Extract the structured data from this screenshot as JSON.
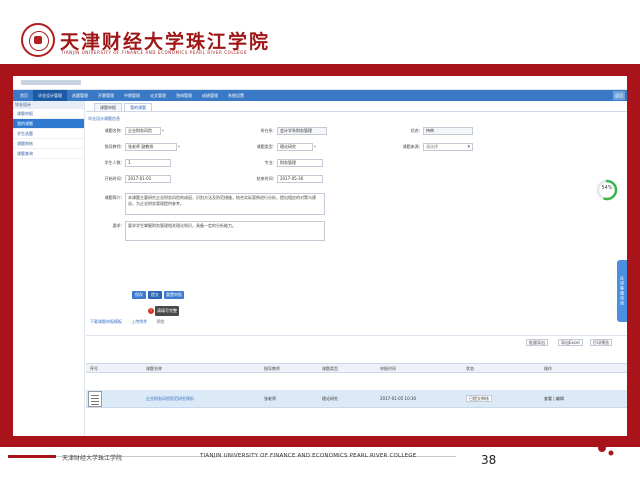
{
  "logo": {
    "cn": "天津财经大学珠江学院",
    "en": "TIANJIN UNIVERSITY OF FINANCE AND ECONOMICS PEARL RIVER COLLEGE"
  },
  "nav": {
    "items": [
      "首页",
      "毕业设计管理",
      "选题管理",
      "开题管理",
      "中期管理",
      "论文管理",
      "答辩管理",
      "成绩管理",
      "系统设置"
    ],
    "home": "返回"
  },
  "sidebar": {
    "head": "毕业设计",
    "items": [
      "课题申报",
      "我的课题",
      "学生选题",
      "课题审核",
      "课题查询"
    ]
  },
  "tabs": [
    "课题申报",
    "我的课题"
  ],
  "form": {
    "section_title": "毕业设计课题信息",
    "row1": {
      "label1": "课题名称:",
      "value1": "企业财务风险",
      "label2": "所在系:",
      "value2": "会计学系财务管理",
      "label3": "状态:",
      "value3": "待审"
    },
    "row2": {
      "label1": "指导教师:",
      "value1": "张老师 副教授",
      "label2": "课题类型:",
      "value2": "理论研究",
      "label3": "课题来源:",
      "value3": "请选择"
    },
    "row3": {
      "label1": "学生人数:",
      "value1": "1",
      "label2": "专业:",
      "value2": "财务管理"
    },
    "row4": {
      "label1": "开始时间:",
      "value1": "2017-01-01",
      "label2": "结束时间:",
      "value2": "2017-05-30"
    },
    "desc_label": "课题简介:",
    "desc_text": "本课题主要研究企业财务风险的成因、识别方法及防范措施，结合实际案例进行分析，提出相应的对策与建议，为企业财务管理提供参考。",
    "req_label": "要求:",
    "req_text": "要求学生掌握财务管理相关理论知识，具备一定的分析能力。"
  },
  "progress": {
    "value": 54,
    "text": "54%",
    "color": "#39b54a"
  },
  "buttons": {
    "save": "保存",
    "submit": "提交",
    "reset": "重置申报"
  },
  "tooltip": "请填写完整",
  "links": {
    "l1": "下载课题申报模板",
    "l2": "上传附件",
    "l3": "预览"
  },
  "side_float": "在线客服咨询",
  "toolbar": {
    "b1": "批量导出",
    "b2": "导出Excel",
    "b3": "打印预览"
  },
  "grid": {
    "columns": [
      "序号",
      "课题名称",
      "指导教师",
      "课题类型",
      "申报时间",
      "状态",
      "操作"
    ],
    "row": {
      "name": "企业财务风险防范研究探析",
      "teacher": "张老师",
      "type": "理论研究",
      "date": "2017-01-05 10:30",
      "status": "已提交审核",
      "op": "查看 | 编辑"
    }
  },
  "footer": {
    "cn": "天津财经大学珠江学院",
    "en": "TIANJIN UNIVERSITY OF FINANCE AND ECONOMICS PEARL RIVER COLLEGE",
    "page": "38"
  },
  "colors": {
    "frame": "#a9141b",
    "nav": "#3a79c6",
    "accent": "#2f7ad1"
  }
}
